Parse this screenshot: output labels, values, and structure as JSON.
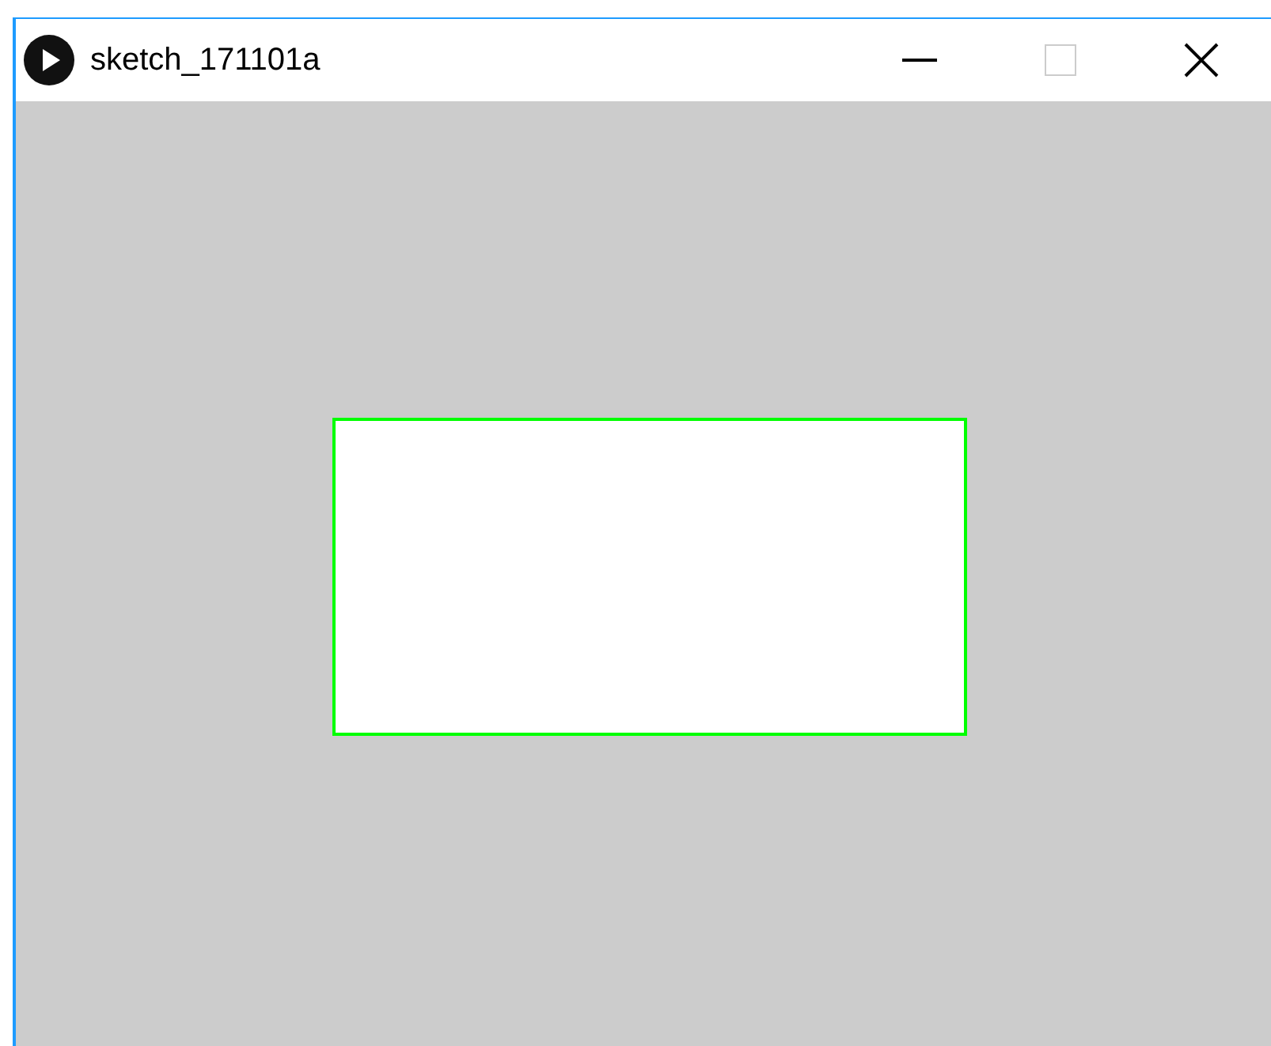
{
  "window": {
    "title": "sketch_171101a",
    "controls": [
      {
        "kind": "minimize",
        "disabled": false
      },
      {
        "kind": "maximize",
        "disabled": true
      },
      {
        "kind": "close",
        "disabled": false
      }
    ]
  },
  "canvas": {
    "shapes": [
      {
        "kind": "rect"
      }
    ]
  }
}
